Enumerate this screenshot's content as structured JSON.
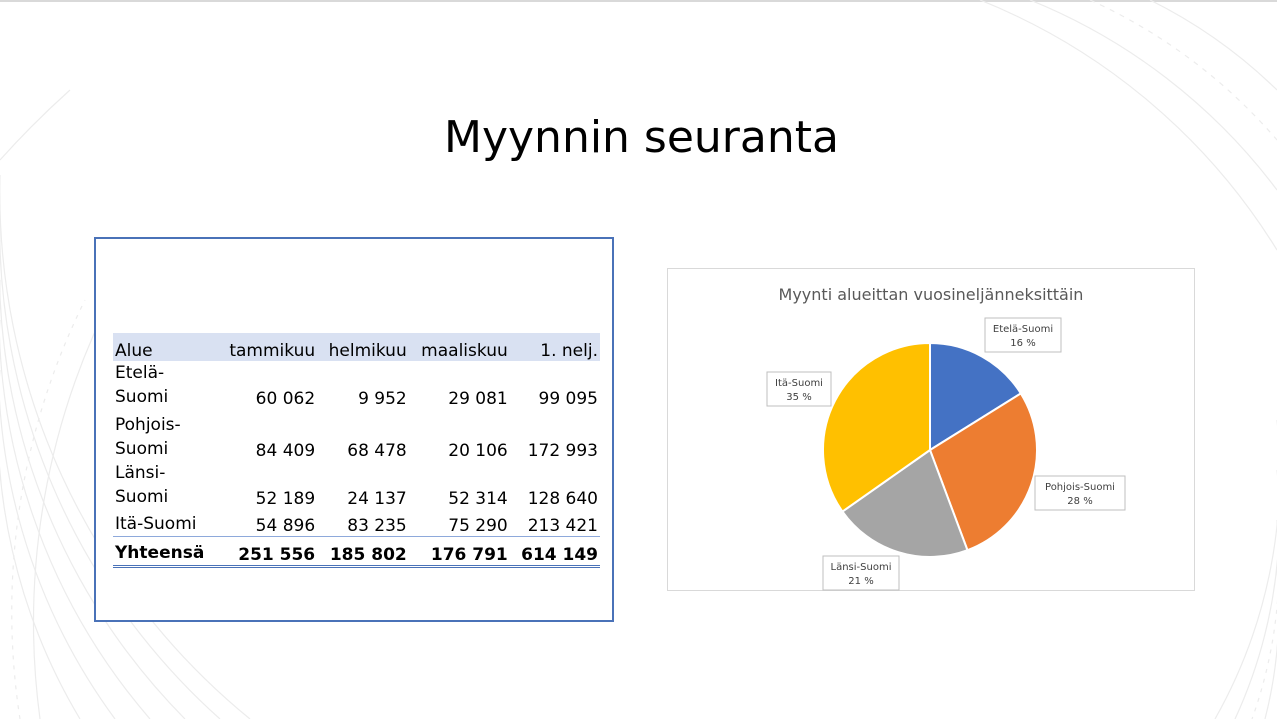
{
  "slide": {
    "title": "Myynnin seuranta"
  },
  "table": {
    "headers": [
      "Alue",
      "tammikuu",
      "helmikuu",
      "maaliskuu",
      "1. nelj."
    ],
    "rows": [
      {
        "region": "Etelä-Suomi",
        "values": [
          "60 062",
          "9 952",
          "29 081",
          "99 095"
        ]
      },
      {
        "region": "Pohjois-Suomi",
        "values": [
          "84 409",
          "68 478",
          "20 106",
          "172 993"
        ]
      },
      {
        "region": "Länsi-Suomi",
        "values": [
          "52 189",
          "24 137",
          "52 314",
          "128 640"
        ]
      },
      {
        "region": "Itä-Suomi",
        "values": [
          "54 896",
          "83 235",
          "75 290",
          "213 421"
        ]
      }
    ],
    "total": {
      "label": "Yhteensä",
      "values": [
        "251 556",
        "185 802",
        "176 791",
        "614 149"
      ]
    }
  },
  "chart_data": {
    "type": "pie",
    "title": "Myynti alueittan vuosineljänneksittäin",
    "categories": [
      "Etelä-Suomi",
      "Pohjois-Suomi",
      "Länsi-Suomi",
      "Itä-Suomi"
    ],
    "values": [
      99095,
      172993,
      128640,
      213421
    ],
    "percent_labels": [
      "16 %",
      "28 %",
      "21 %",
      "35 %"
    ],
    "colors": [
      "#4472c4",
      "#ed7d31",
      "#a5a5a5",
      "#ffc000"
    ],
    "legend": "none",
    "data_labels": "callouts"
  }
}
